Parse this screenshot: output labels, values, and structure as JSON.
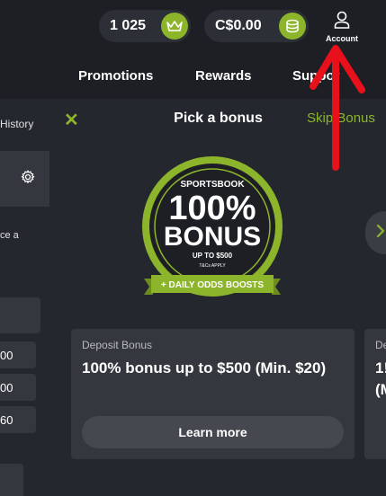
{
  "header": {
    "points": "1 025",
    "points_icon": "crown-icon",
    "balance": "C$0.00",
    "balance_icon": "coins-icon",
    "account_label": "Account",
    "account_icon": "user-icon"
  },
  "nav": {
    "items": [
      {
        "label": "Promotions"
      },
      {
        "label": "Rewards"
      },
      {
        "label": "Suppor"
      }
    ]
  },
  "left_panel": {
    "history_label": "History",
    "text_snippet": "ce a",
    "odds": [
      "00",
      "00",
      "60"
    ],
    "settings_icon": "gear-icon"
  },
  "modal": {
    "title": "Pick a bonus",
    "skip_label": "Skip Bonus",
    "close_icon": "close-icon",
    "badge": {
      "top_label": "SPORTSBOOK",
      "headline": "100%",
      "subheadline": "BONUS",
      "limit": "UP TO $500",
      "terms": "T&Cs APPLY",
      "ribbon": "+ DAILY ODDS BOOSTS"
    },
    "next_icon": "chevron-right-icon",
    "cards": [
      {
        "type": "Deposit Bonus",
        "title": "100% bonus up to $500 (Min. $20)",
        "cta": "Learn more"
      },
      {
        "type": "De",
        "title": "1!\n(M"
      }
    ]
  },
  "colors": {
    "accent": "#8cb52c",
    "background": "#1d1f24",
    "panel": "#24272d",
    "card": "#34373d",
    "annotation_arrow": "#e8101a"
  }
}
